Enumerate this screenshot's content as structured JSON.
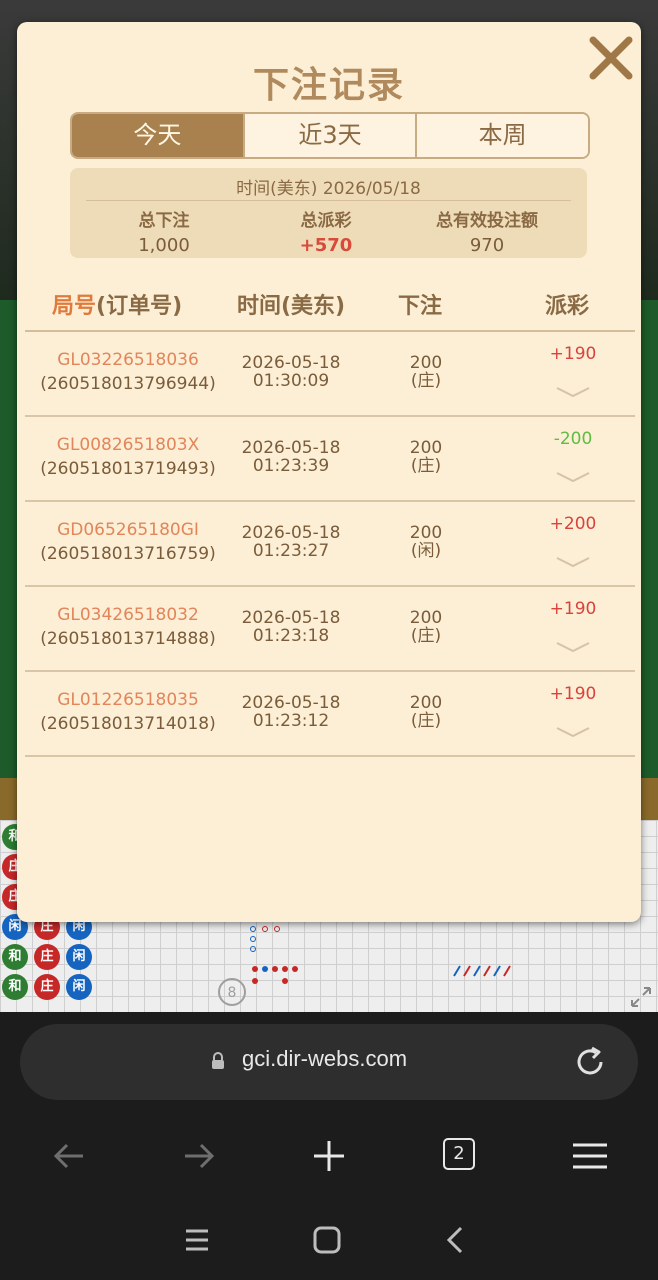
{
  "modal": {
    "title": "下注记录",
    "tabs": [
      {
        "label": "今天",
        "active": true
      },
      {
        "label": "近3天",
        "active": false
      },
      {
        "label": "本周",
        "active": false
      }
    ],
    "summary": {
      "date": "时间(美东) 2026/05/18",
      "total_bet_label": "总下注",
      "total_bet": "1,000",
      "total_payout_label": "总派彩",
      "total_payout": "+570",
      "valid_bet_label": "总有效投注额",
      "valid_bet": "970"
    },
    "table": {
      "col_order_prefix": "局号",
      "col_order_suffix": "(订单号)",
      "col_time": "时间(美东)",
      "col_bet": "下注",
      "col_payout": "派彩",
      "rows": [
        {
          "game_id": "GL03226518036",
          "order_no": "(260518013796944)",
          "date": "2026-05-18",
          "time": "01:30:09",
          "amount": "200",
          "side": "(庄)",
          "payout": "+190",
          "result": "win"
        },
        {
          "game_id": "GL0082651803X",
          "order_no": "(260518013719493)",
          "date": "2026-05-18",
          "time": "01:23:39",
          "amount": "200",
          "side": "(庄)",
          "payout": "-200",
          "result": "lose"
        },
        {
          "game_id": "GD065265180GI",
          "order_no": "(260518013716759)",
          "date": "2026-05-18",
          "time": "01:23:27",
          "amount": "200",
          "side": "(闲)",
          "payout": "+200",
          "result": "win"
        },
        {
          "game_id": "GL03426518032",
          "order_no": "(260518013714888)",
          "date": "2026-05-18",
          "time": "01:23:18",
          "amount": "200",
          "side": "(庄)",
          "payout": "+190",
          "result": "win"
        },
        {
          "game_id": "GL01226518035",
          "order_no": "(260518013714018)",
          "date": "2026-05-18",
          "time": "01:23:12",
          "amount": "200",
          "side": "(庄)",
          "payout": "+190",
          "result": "win"
        }
      ]
    }
  },
  "background": {
    "road_columns": [
      [
        "和",
        "庄",
        "庄",
        "闲",
        "和",
        "和"
      ],
      [
        "",
        "",
        "",
        "庄",
        "庄",
        "庄"
      ],
      [
        "",
        "",
        "",
        "闲",
        "闲",
        "闲"
      ]
    ],
    "badge_number": "8"
  },
  "browser": {
    "url": "gci.dir-webs.com",
    "tab_count": "2"
  },
  "colors": {
    "modal_bg": "#fcefd6",
    "tab_active": "#a8814f",
    "accent_orange": "#e07a3c",
    "win": "#d8433c",
    "lose": "#5fbd40"
  }
}
